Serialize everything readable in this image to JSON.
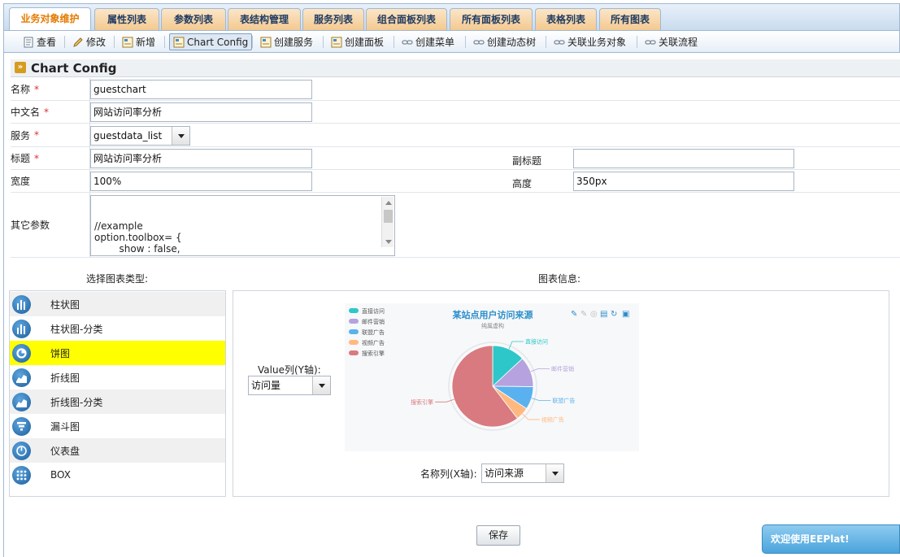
{
  "tabs": [
    {
      "label": "业务对象维护",
      "active": true
    },
    {
      "label": "属性列表"
    },
    {
      "label": "参数列表"
    },
    {
      "label": "表结构管理"
    },
    {
      "label": "服务列表"
    },
    {
      "label": "组合面板列表"
    },
    {
      "label": "所有面板列表"
    },
    {
      "label": "表格列表"
    },
    {
      "label": "所有图表"
    }
  ],
  "toolbar": {
    "view": "查看",
    "edit": "修改",
    "add": "新增",
    "chart_config": "Chart Config",
    "create_service": "创建服务",
    "create_panel": "创建面板",
    "create_menu": "创建菜单",
    "create_dynamic_tree": "创建动态树",
    "link_bizobj": "关联业务对象",
    "link_flow": "关联流程"
  },
  "section_title": "Chart Config",
  "form": {
    "name_label": "名称",
    "name_value": "guestchart",
    "cn_name_label": "中文名",
    "cn_name_value": "网站访问率分析",
    "service_label": "服务",
    "service_value": "guestdata_list",
    "title_label": "标题",
    "title_value": "网站访问率分析",
    "subtitle_label": "副标题",
    "subtitle_value": "",
    "width_label": "宽度",
    "width_value": "100%",
    "height_label": "高度",
    "height_value": "350px",
    "other_label": "其它参数",
    "other_value": "//example\noption.toolbox= {\n        show : false,\n        feature : {\n            mark : {show: true},",
    "required_mark": "*"
  },
  "chart_type_heading": "选择图表类型:",
  "chart_info_heading": "图表信息:",
  "chart_types": [
    {
      "label": "柱状图",
      "icon": "bar-chart-icon"
    },
    {
      "label": "柱状图-分类",
      "icon": "bar-chart-icon"
    },
    {
      "label": "饼图",
      "icon": "pie-chart-icon",
      "selected": true
    },
    {
      "label": "折线图",
      "icon": "line-chart-icon"
    },
    {
      "label": "折线图-分类",
      "icon": "line-chart-icon"
    },
    {
      "label": "漏斗图",
      "icon": "funnel-chart-icon"
    },
    {
      "label": "仪表盘",
      "icon": "gauge-icon"
    },
    {
      "label": "BOX",
      "icon": "grid-dots-icon"
    }
  ],
  "value_col_label": "Value列(Y轴):",
  "value_col_value": "访问量",
  "name_col_label": "名称列(X轴):",
  "name_col_value": "访问来源",
  "save_label": "保存",
  "welcome_text": "欢迎使用EEPlat!",
  "chart_data": {
    "type": "pie",
    "title": "某站点用户访问来源",
    "subtitle": "纯属虚构",
    "categories": [
      "直接访问",
      "邮件营销",
      "联盟广告",
      "视频广告",
      "搜索引擎"
    ],
    "values": [
      335,
      310,
      234,
      135,
      1548
    ],
    "colors": [
      "#2ec7c9",
      "#b6a2de",
      "#5ab1ef",
      "#ffb980",
      "#d87a80"
    ],
    "legend": "top-left"
  }
}
